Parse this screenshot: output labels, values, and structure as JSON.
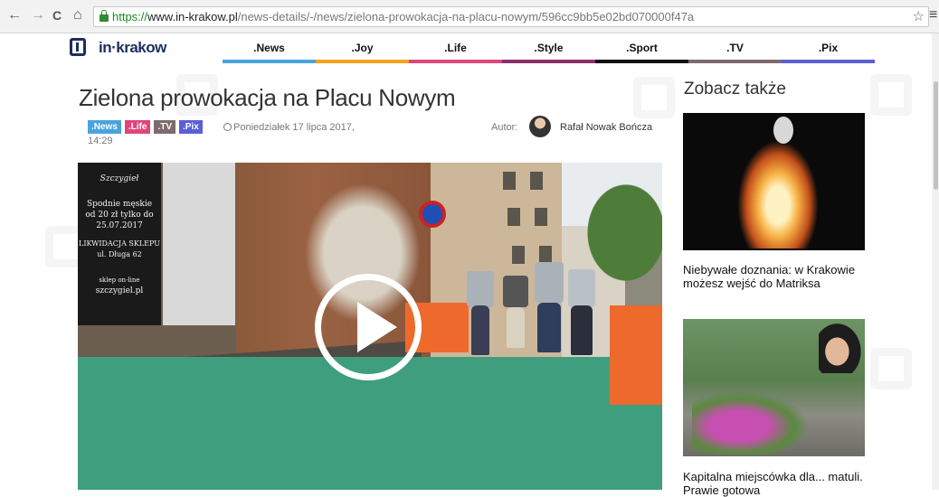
{
  "browser": {
    "back_icon": "←",
    "forward_icon": "→",
    "reload_icon": "C",
    "home_icon": "⌂",
    "url_scheme": "https://",
    "url_host": "www.in-krakow.pl",
    "url_path": "/news-details/-/news/zielona-prowokacja-na-placu-nowym/596cc9bb5e02bd070000f47a",
    "star_icon": "☆",
    "menu_icon": "≡"
  },
  "site": {
    "logo_text": "in·krakow",
    "nav": [
      {
        "label": ".News",
        "color": "#4aa3df"
      },
      {
        "label": ".Joy",
        "color": "#f3a21f"
      },
      {
        "label": ".Life",
        "color": "#e0457b"
      },
      {
        "label": ".Style",
        "color": "#8e2e69"
      },
      {
        "label": ".Sport",
        "color": "#111111"
      },
      {
        "label": ".TV",
        "color": "#7d6b6e"
      },
      {
        "label": ".Pix",
        "color": "#5a5fd6"
      }
    ]
  },
  "article": {
    "title": "Zielona prowokacja na Placu Nowym",
    "tags": [
      {
        "label": ".News",
        "color": "#4aa3df"
      },
      {
        "label": ".Life",
        "color": "#e0457b"
      },
      {
        "label": ".TV",
        "color": "#7d6b6e"
      },
      {
        "label": ".Pix",
        "color": "#5a5fd6"
      }
    ],
    "date": "Poniedziałek 17 lipca 2017,",
    "time": "14:29",
    "author_label": "Autor:",
    "author_name": "Rafał Nowak Bończa",
    "video": {
      "poster_lines": [
        "Szczygieł",
        "Spodnie męskie",
        "od 20 zł tylko do",
        "25.07.2017",
        "LIKWIDACJA SKLEPU",
        "ul. Długa 62",
        "sklep on-line",
        "szczygiel.pl"
      ]
    }
  },
  "sidebar": {
    "title": "Zobacz także",
    "items": [
      {
        "caption": "Niebywałe doznania: w Krakowie możesz wejść do Matriksa"
      },
      {
        "caption": "Kapitalna miejscówka dla... matuli. Prawie gotowa"
      }
    ]
  }
}
